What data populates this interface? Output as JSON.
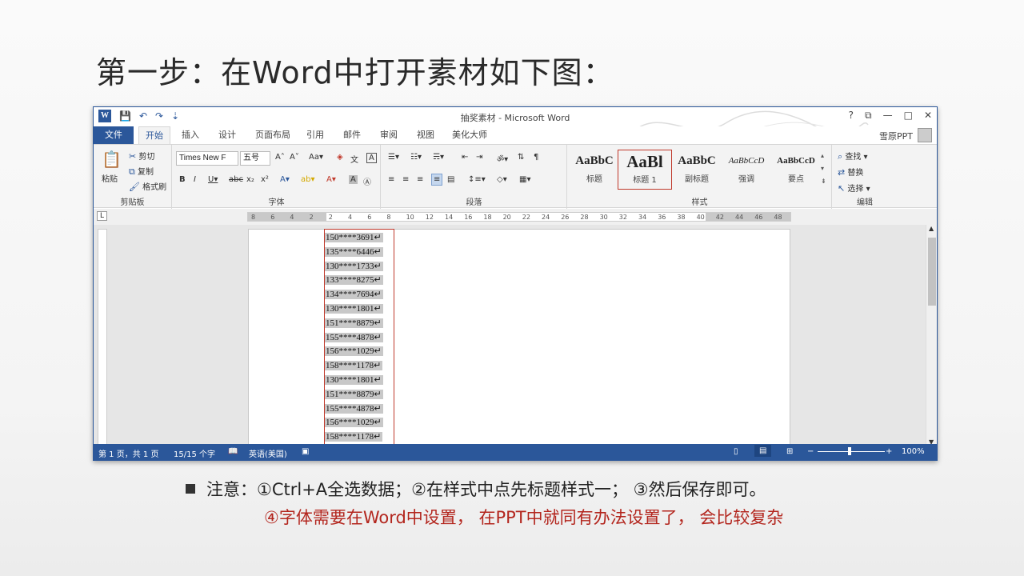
{
  "slide_title": "第一步：在Word中打开素材如下图：",
  "window": {
    "title": "抽奖素材 - Microsoft Word",
    "qat": [
      "💾",
      "↶",
      "↷",
      "⇣"
    ],
    "controls": [
      "?",
      "⧉",
      "—",
      "□",
      "✕"
    ],
    "user": "雪原PPT"
  },
  "tabs": [
    "文件",
    "开始",
    "插入",
    "设计",
    "页面布局",
    "引用",
    "邮件",
    "审阅",
    "视图",
    "美化大师"
  ],
  "ribbon": {
    "clipboard": {
      "paste": "粘贴",
      "cut": "剪切",
      "copy": "复制",
      "format_painter": "格式刷",
      "label": "剪贴板"
    },
    "font": {
      "name": "Times New F",
      "size": "五号",
      "label": "字体"
    },
    "paragraph": {
      "label": "段落"
    },
    "styles": {
      "label": "样式",
      "items": [
        {
          "preview": "AaBbC",
          "name": "标题"
        },
        {
          "preview": "AaBl",
          "name": "标题 1"
        },
        {
          "preview": "AaBbC",
          "name": "副标题"
        },
        {
          "preview": "AaBbCcD",
          "name": "强调"
        },
        {
          "preview": "AaBbCcD",
          "name": "要点"
        }
      ]
    },
    "editing": {
      "find": "查找",
      "replace": "替换",
      "select": "选择",
      "label": "编辑"
    }
  },
  "ruler_numbers": [
    "8",
    "6",
    "4",
    "2",
    "2",
    "4",
    "6",
    "8",
    "10",
    "12",
    "14",
    "16",
    "18",
    "20",
    "22",
    "24",
    "26",
    "28",
    "30",
    "32",
    "34",
    "36",
    "38",
    "40",
    "42",
    "44",
    "46",
    "48"
  ],
  "document_lines": [
    "150****3691",
    "135****6446",
    "130****1733",
    "133****8275",
    "134****7694",
    "130****1801",
    "151****8879",
    "155****4878",
    "156****1029",
    "158****1178",
    "130****1801",
    "151****8879",
    "155****4878",
    "156****1029",
    "158****1178"
  ],
  "status": {
    "page": "第 1 页，共 1 页",
    "words": "15/15 个字",
    "lang": "英语(美国)",
    "zoom": "100%"
  },
  "notes": {
    "line1": "注意：①Ctrl+A全选数据；②在样式中点先标题样式一； ③然后保存即可。",
    "line2": "④字体需要在Word中设置， 在PPT中就同有办法设置了， 会比较复杂"
  },
  "colors": {
    "accent": "#2b579a",
    "highlight_red": "#c0392b",
    "note_red": "#b3261e"
  }
}
